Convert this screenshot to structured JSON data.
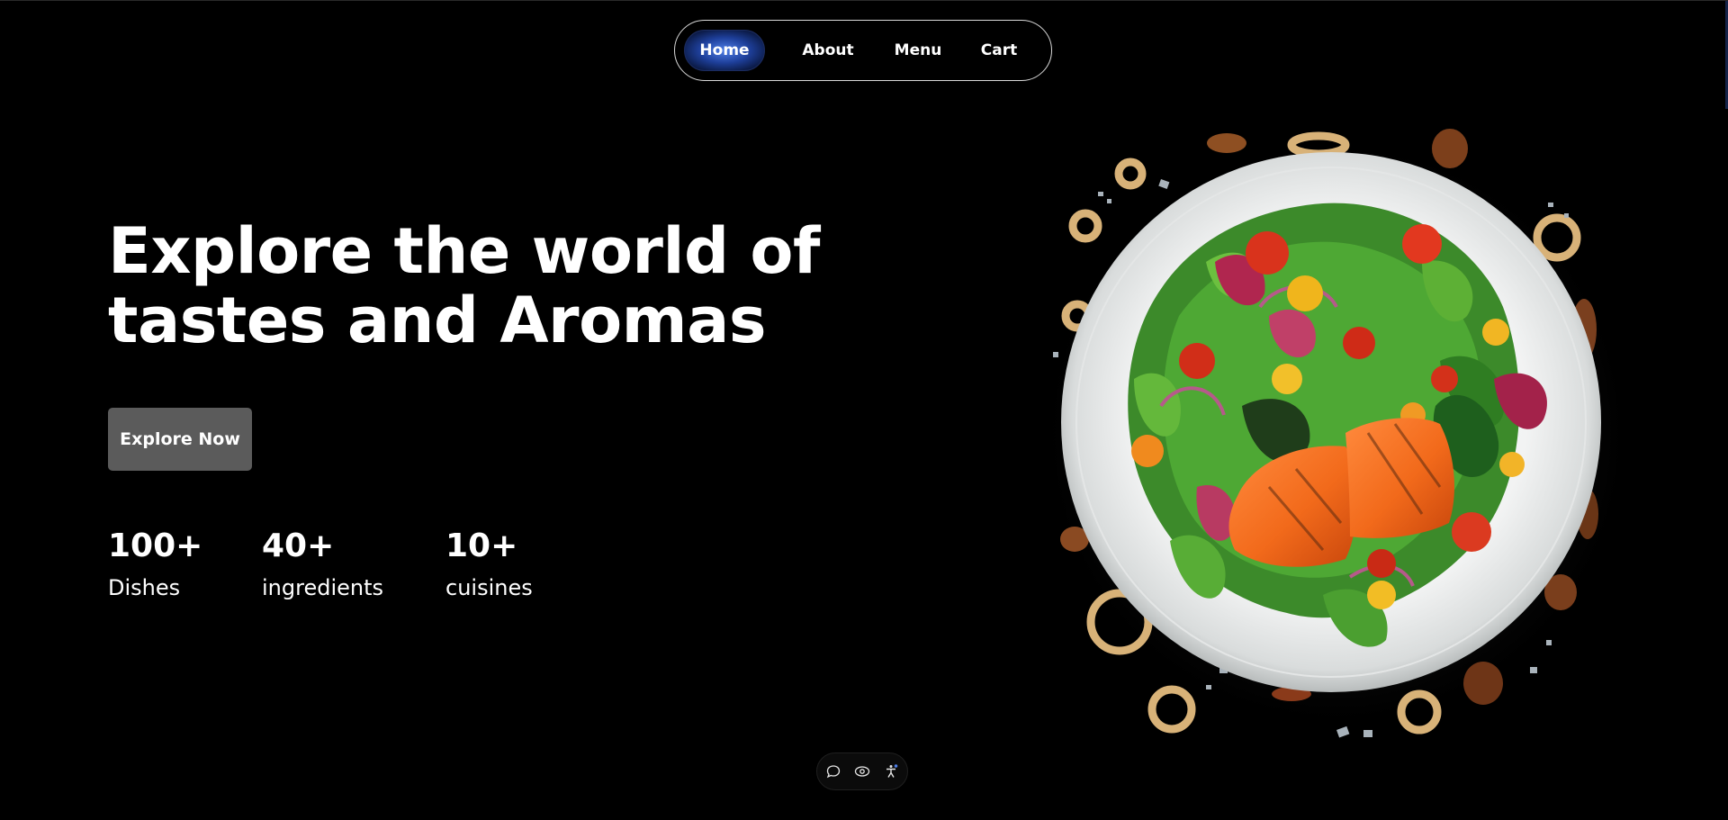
{
  "nav": {
    "items": [
      {
        "label": "Home",
        "active": true
      },
      {
        "label": "About"
      },
      {
        "label": "Menu"
      },
      {
        "label": "Cart"
      }
    ],
    "active_gradient": [
      "#4f7fe8",
      "#071030"
    ]
  },
  "hero": {
    "title_line1": "Explore the world of",
    "title_line2": "tastes and Aromas",
    "cta_label": "Explore Now",
    "cta_color": "#5b5b5b"
  },
  "stats": [
    {
      "value": "100+",
      "label": "Dishes"
    },
    {
      "value": "40+",
      "label": "ingredients"
    },
    {
      "value": "10+",
      "label": "cuisines"
    }
  ],
  "image": {
    "subject": "grilled salmon salad plate",
    "icon": "dish-image"
  },
  "dock": {
    "icons": [
      "chat-bubble-icon",
      "eye-icon",
      "accessibility-icon"
    ]
  },
  "colors": {
    "background": "#000000",
    "text": "#ffffff",
    "nav_border": "#d9d9d9"
  }
}
